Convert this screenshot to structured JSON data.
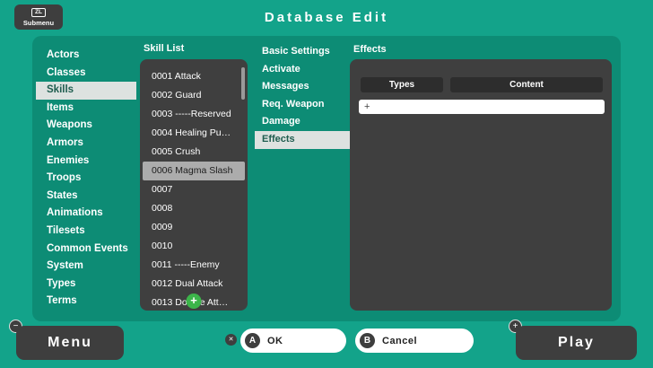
{
  "header": {
    "title": "Database Edit",
    "submenu_button": {
      "badge": "ZL",
      "label": "Submenu"
    }
  },
  "sidebar": {
    "items": [
      "Actors",
      "Classes",
      "Skills",
      "Items",
      "Weapons",
      "Armors",
      "Enemies",
      "Troops",
      "States",
      "Animations",
      "Tilesets",
      "Common Events",
      "System",
      "Types",
      "Terms"
    ],
    "selected": "Skills"
  },
  "skill_list": {
    "title": "Skill List",
    "items": [
      "0001 Attack",
      "0002 Guard",
      "0003 -----Reserved",
      "0004 Healing Pu…",
      "0005 Crush",
      "0006 Magma Slash",
      "0007",
      "0008",
      "0009",
      "0010",
      "0011 -----Enemy",
      "0012 Dual Attack",
      "0013 Double Att…"
    ],
    "selected": "0006 Magma Slash",
    "add_button": "+"
  },
  "settings_nav": {
    "items": [
      "Basic Settings",
      "Activate",
      "Messages",
      "Req. Weapon",
      "Damage",
      "Effects"
    ],
    "selected": "Effects"
  },
  "effects": {
    "title": "Effects",
    "columns": [
      "Types",
      "Content"
    ],
    "add_row": "+"
  },
  "footer": {
    "menu": {
      "label": "Menu",
      "badge": "−"
    },
    "x_badge": "✕",
    "ok": {
      "badge": "A",
      "label": "OK"
    },
    "cancel": {
      "badge": "B",
      "label": "Cancel"
    },
    "play": {
      "label": "Play",
      "badge": "+"
    }
  },
  "colors": {
    "background": "#13A38A",
    "panel": "#0D8C75",
    "dark_button": "#3E3E3E",
    "nav_highlight": "#DDE2E0",
    "selected_row": "#ACACAC",
    "accent_green": "#3CB54A"
  }
}
